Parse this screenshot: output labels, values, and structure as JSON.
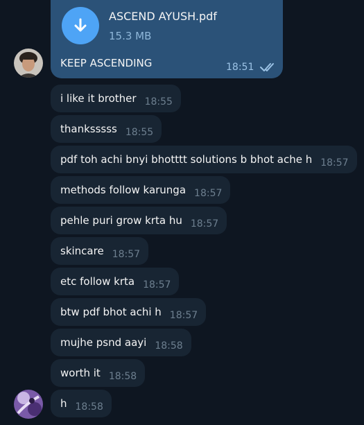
{
  "file_message": {
    "name": "ASCEND AYUSH.pdf",
    "size": "15.3 MB",
    "caption": "KEEP ASCENDING",
    "time": "18:51",
    "icon": "download-icon",
    "status_icon": "double-check-icon"
  },
  "messages": [
    {
      "text": "i like it brother",
      "time": "18:55"
    },
    {
      "text": "thanksssss",
      "time": "18:55"
    },
    {
      "text": "pdf toh achi bnyi bhotttt solutions b bhot ache h",
      "time": "18:57"
    },
    {
      "text": "methods follow karunga",
      "time": "18:57"
    },
    {
      "text": "pehle puri grow krta hu",
      "time": "18:57"
    },
    {
      "text": "skincare",
      "time": "18:57"
    },
    {
      "text": "etc follow krta",
      "time": "18:57"
    },
    {
      "text": "btw pdf bhot achi h",
      "time": "18:57"
    },
    {
      "text": "mujhe psnd aayi",
      "time": "18:58"
    },
    {
      "text": "worth it",
      "time": "18:58"
    },
    {
      "text": "h",
      "time": "18:58"
    }
  ],
  "colors": {
    "background": "#0e1621",
    "incoming_bubble": "#182533",
    "outgoing_bubble": "#2b5278",
    "accent": "#4ea4f6"
  }
}
